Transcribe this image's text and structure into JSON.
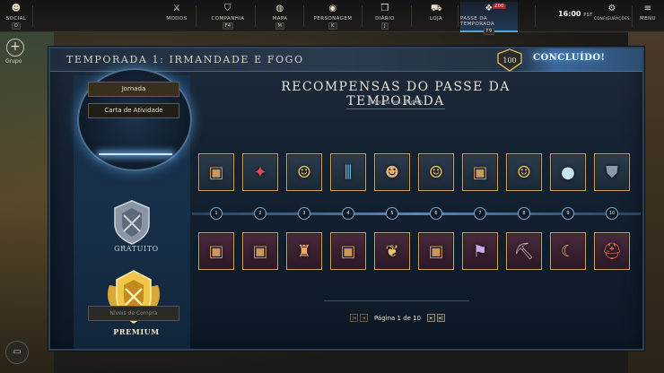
{
  "nav": {
    "social": {
      "label": "SOCIAL",
      "key": "O"
    },
    "items": [
      {
        "label": "MODOS",
        "key": ""
      },
      {
        "label": "COMPANHIA",
        "key": "F4"
      },
      {
        "label": "MAPA",
        "key": "M"
      },
      {
        "label": "PERSONAGEM",
        "key": "K"
      },
      {
        "label": "DIÁRIO",
        "key": "J"
      },
      {
        "label": "LOJA",
        "key": ""
      },
      {
        "label": "PASSE DA TEMPORADA",
        "key": "F9"
      }
    ],
    "season_badge": "200",
    "clock_time": "16:00",
    "clock_zone": "PST",
    "settings": "CONFIGURAÇÕES",
    "menu": "MENU"
  },
  "left_rail": {
    "group_label": "Grupo"
  },
  "header": {
    "season_title": "TEMPORADA 1: IRMANDADE E FOGO",
    "level": "100",
    "status": "CONCLUÍDO!"
  },
  "tabs": {
    "journey": "Jornada",
    "activity": "Carta de Atividade"
  },
  "tracks": {
    "free_label": "GRATUITO",
    "premium_label": "PREMIUM",
    "buy_levels": "Níveis de Compra"
  },
  "rewards": {
    "title": "RECOMPENSAS DO PASSE DA TEMPORADA",
    "ends": "Termina em: 94d 8h",
    "levels": [
      "1",
      "2",
      "3",
      "4",
      "5",
      "6",
      "7",
      "8",
      "9",
      "10"
    ],
    "free": [
      "chest-icon",
      "gems-icon",
      "emote-icon",
      "vials-icon",
      "masks-icon",
      "emote-icon",
      "chest-icon",
      "emote-icon",
      "orbs-icon",
      "armor-icon"
    ],
    "premium": [
      "chest-icon",
      "chest-icon",
      "pose-icon",
      "chest-icon",
      "seeds-icon",
      "chest-icon",
      "banner-icon",
      "pickaxe-icon",
      "sickle-icon",
      "helmet-icon"
    ]
  },
  "pager": {
    "label": "Página 1 de 10"
  },
  "colors": {
    "accent": "#5aa0e0",
    "gold": "#c9a35a"
  }
}
